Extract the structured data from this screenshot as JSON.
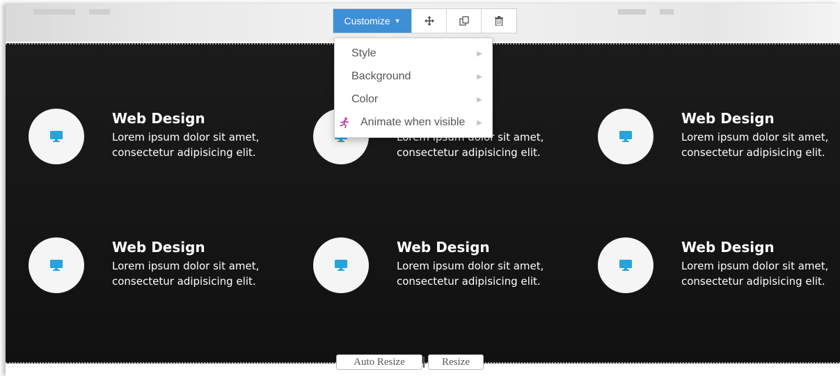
{
  "toolbar": {
    "customize_label": "Customize",
    "move_icon": "move-icon",
    "duplicate_icon": "duplicate-icon",
    "delete_icon": "trash-icon",
    "accent_color": "#3f8fd4"
  },
  "menu": {
    "items": [
      {
        "label": "Style"
      },
      {
        "label": "Background"
      },
      {
        "label": "Color"
      },
      {
        "label": "Animate when visible",
        "icon": "running-figure-icon"
      }
    ]
  },
  "features": [
    {
      "title": "Web Design",
      "text": "Lorem ipsum dolor sit amet, consectetur adipisicing elit."
    },
    {
      "title": "",
      "text": "Lorem ipsum dolor sit amet, consectetur adipisicing elit."
    },
    {
      "title": "Web Design",
      "text": "Lorem ipsum dolor sit amet, consectetur adipisicing elit."
    },
    {
      "title": "Web Design",
      "text": "Lorem ipsum dolor sit amet, consectetur adipisicing elit."
    },
    {
      "title": "Web Design",
      "text": "Lorem ipsum dolor sit amet, consectetur adipisicing elit."
    },
    {
      "title": "Web Design",
      "text": "Lorem ipsum dolor sit amet, consectetur adipisicing elit."
    }
  ],
  "feature_icon": "monitor-icon",
  "icon_color": "#29a3d9",
  "resize": {
    "auto_label": "Auto Resize",
    "resize_label": "Resize"
  }
}
